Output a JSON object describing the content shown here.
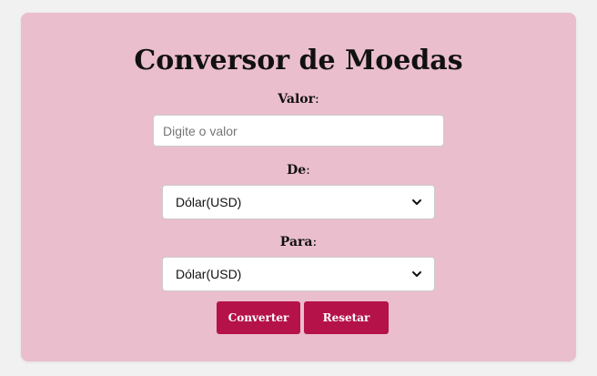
{
  "title": "Conversor de Moedas",
  "valor": {
    "label": "Valor",
    "colon": ":",
    "placeholder": "Digite o valor",
    "value": ""
  },
  "de": {
    "label": "De",
    "colon": ":",
    "selected": "Dólar(USD)"
  },
  "para": {
    "label": "Para",
    "colon": ":",
    "selected": "Dólar(USD)"
  },
  "buttons": {
    "convert": "Converter",
    "reset": "Resetar"
  },
  "colors": {
    "card_background": "#eabecc",
    "button_background": "#b5124a",
    "page_background": "#f1f1f1"
  }
}
